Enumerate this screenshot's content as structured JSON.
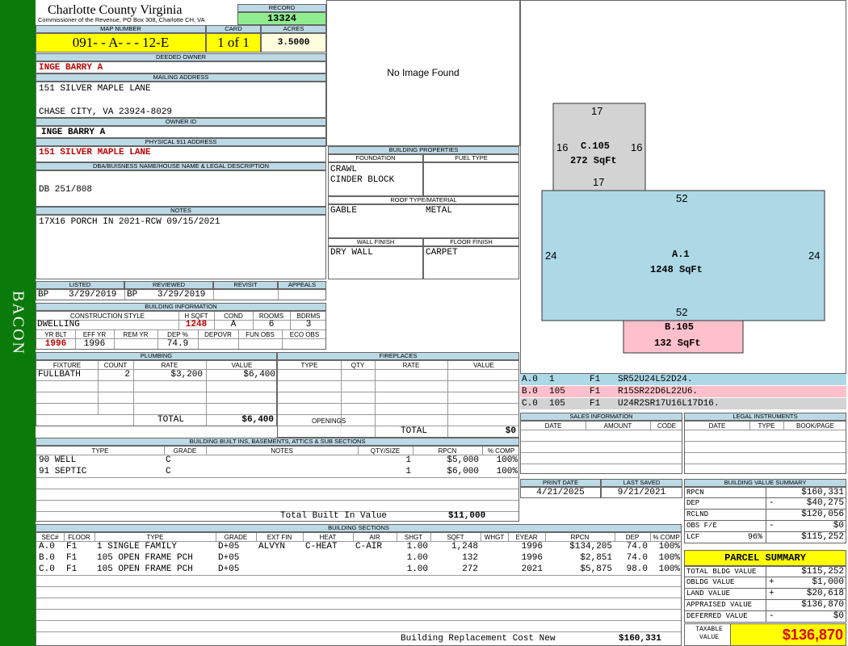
{
  "side_label": "BACON",
  "county": {
    "name": "Charlotte County Virginia",
    "sub": "Commissioner of the Revenue, PO Box 308, Charlotte CH, VA"
  },
  "record": {
    "label": "RECORD",
    "value": "13324"
  },
  "map": {
    "label": "MAP NUMBER",
    "value": "091- - A- - - 12-E"
  },
  "card": {
    "label": "CARD",
    "value": "1 of 1"
  },
  "acres": {
    "label": "ACRES",
    "value": "3.5000"
  },
  "deeded_owner": {
    "label": "DEEDED OWNER",
    "value": "INGE BARRY A"
  },
  "mailing": {
    "label": "MAILING ADDRESS",
    "line1": "151 SILVER MAPLE LANE",
    "line2": "CHASE CITY, VA 23924-8029"
  },
  "owner_id": {
    "label": "OWNER ID",
    "value": "INGE BARRY A"
  },
  "physical": {
    "label": "PHYSICAL 911 ADDRESS",
    "value": "151 SILVER MAPLE LANE"
  },
  "dba": {
    "label": "DBA/BUISNESS NAME/HOUSE NAME & LEGAL DESCRIPTION",
    "value": "DB 251/808"
  },
  "notes": {
    "label": "NOTES",
    "value": "17X16 PORCH IN 2021-RCW 09/15/2021"
  },
  "image_text": "No Image Found",
  "building_props": {
    "label": "BUILDING PROPERTIES",
    "foundation_label": "FOUNDATION",
    "fuel_label": "FUEL TYPE",
    "foundation1": "CRAWL",
    "foundation2": "CINDER BLOCK",
    "fuel": "",
    "roof_label": "ROOF TYPE/MATERIAL",
    "roof_type": "GABLE",
    "roof_material": "METAL",
    "wall_label": "WALL FINISH",
    "floor_label": "FLOOR FINISH",
    "wall": "DRY WALL",
    "floor": "CARPET"
  },
  "review": {
    "listed_label": "LISTED",
    "reviewed_label": "REVIEWED",
    "revisit_label": "REVISIT",
    "appeals_label": "APPEALS",
    "listed_by": "BP",
    "listed_date": "3/29/2019",
    "reviewed_by": "BP",
    "reviewed_date": "3/29/2019",
    "revisit": "",
    "appeals": ""
  },
  "building_info": {
    "label": "BUILDING INFORMATION",
    "construction_label": "CONSTRUCTION STYLE",
    "hsqft_label": "H SQFT",
    "cond_label": "COND",
    "rooms_label": "ROOMS",
    "bdrms_label": "BDRMS",
    "construction": "DWELLING",
    "hsqft": "1248",
    "cond": "A",
    "rooms": "6",
    "bdrms": "3",
    "yrblt_label": "YR BLT",
    "effyr_label": "EFF YR",
    "remyr_label": "REM YR",
    "dep_label": "DEP %",
    "depovr_label": "DEPOVR",
    "funobs_label": "FUN OBS",
    "ecoobs_label": "ECO OBS",
    "yrblt": "1996",
    "effyr": "1996",
    "remyr": "",
    "dep": "74.9",
    "depovr": "",
    "funobs": "",
    "ecoobs": ""
  },
  "plumbing": {
    "label": "PLUMBING",
    "fixture_label": "FIXTURE",
    "count_label": "COUNT",
    "rate_label": "RATE",
    "value_label": "VALUE",
    "rows": [
      {
        "fixture": "FULLBATH",
        "count": "2",
        "rate": "$3,200",
        "value": "$6,400"
      }
    ],
    "total_label": "TOTAL",
    "total": "$6,400"
  },
  "fireplaces": {
    "label": "FIREPLACES",
    "type_label": "TYPE",
    "qty_label": "QTY",
    "rate_label": "RATE",
    "value_label": "VALUE",
    "openings_label": "OPENINGS",
    "total_label": "TOTAL",
    "total": "$0"
  },
  "builtins": {
    "label": "BUILDING BUILT INS, BASEMENTS, ATTICS & SUB SECTIONS",
    "type_label": "TYPE",
    "grade_label": "GRADE",
    "notes_label": "NOTES",
    "qty_label": "QTY/SIZE",
    "rpcn_label": "RPCN",
    "comp_label": "% COMP",
    "rows": [
      {
        "type": "90 WELL",
        "grade": "C",
        "notes": "",
        "qty": "1",
        "rpcn": "$5,000",
        "comp": "100%"
      },
      {
        "type": "91 SEPTIC",
        "grade": "C",
        "notes": "",
        "qty": "1",
        "rpcn": "$6,000",
        "comp": "100%"
      }
    ],
    "total_label": "Total Built In Value",
    "total": "$11,000"
  },
  "sections": {
    "label": "BUILDING SECTIONS",
    "headers": [
      "SEC#",
      "FLOOR",
      "TYPE",
      "GRADE",
      "EXT FIN",
      "HEAT",
      "AIR",
      "SHGT",
      "SQFT",
      "WHGT",
      "EYEAR",
      "RPCN",
      "DEP",
      "% COMP"
    ],
    "rows": [
      {
        "sec": "A.0",
        "floor": "F1",
        "type": "1 SINGLE FAMILY",
        "grade": "D+05",
        "extfin": "ALVYN",
        "heat": "C-HEAT",
        "air": "C-AIR",
        "shgt": "1.00",
        "sqft": "1,248",
        "whgt": "",
        "eyear": "1996",
        "rpcn": "$134,205",
        "dep": "74.0",
        "comp": "100%"
      },
      {
        "sec": "B.0",
        "floor": "F1",
        "type": "105 OPEN FRAME PCH",
        "grade": "D+05",
        "extfin": "",
        "heat": "",
        "air": "",
        "shgt": "1.00",
        "sqft": "132",
        "whgt": "",
        "eyear": "1996",
        "rpcn": "$2,851",
        "dep": "74.0",
        "comp": "100%"
      },
      {
        "sec": "C.0",
        "floor": "F1",
        "type": "105 OPEN FRAME PCH",
        "grade": "D+05",
        "extfin": "",
        "heat": "",
        "air": "",
        "shgt": "1.00",
        "sqft": "272",
        "whgt": "",
        "eyear": "2021",
        "rpcn": "$5,875",
        "dep": "98.0",
        "comp": "100%"
      }
    ],
    "replacement_label": "Building Replacement Cost New",
    "replacement": "$160,331"
  },
  "sketch": {
    "c_top": "17",
    "c_left": "16",
    "c_right": "16",
    "c_bottom": "17",
    "c_name": "C.105",
    "c_area": "272 SqFt",
    "a_top": "52",
    "a_left": "24",
    "a_right": "24",
    "a_bottom": "52",
    "a_name": "A.1",
    "a_area": "1248 SqFt",
    "b_name": "B.105",
    "b_area": "132 SqFt",
    "colors": {
      "a": "#add8e6",
      "b": "#ffc0cb",
      "c": "#d3d3d3"
    }
  },
  "legend": [
    {
      "sec": "A.0",
      "code": "1",
      "floor": "F1",
      "path": "SR52U24L52D24."
    },
    {
      "sec": "B.0",
      "code": "105",
      "floor": "F1",
      "path": "R15SR22D6L22U6."
    },
    {
      "sec": "C.0",
      "code": "105",
      "floor": "F1",
      "path": "U24R2SR17U16L17D16."
    }
  ],
  "sales": {
    "label": "SALES INFORMATION",
    "date_label": "DATE",
    "amount_label": "AMOUNT",
    "code_label": "CODE"
  },
  "legal": {
    "label": "LEGAL INSTRUMENTS",
    "date_label": "DATE",
    "type_label": "TYPE",
    "book_label": "BOOK/PAGE"
  },
  "print": {
    "print_label": "PRINT DATE",
    "saved_label": "LAST SAVED",
    "print_date": "4/21/2025",
    "saved_date": "9/21/2021"
  },
  "value_summary": {
    "label": "BUILDING VALUE SUMMARY",
    "rows": [
      {
        "label": "RPCN",
        "sign": "",
        "value": "$160,331"
      },
      {
        "label": "DEP",
        "sign": "-",
        "value": "$40,275"
      },
      {
        "label": "RCLND",
        "sign": "",
        "value": "$120,056"
      },
      {
        "label": "OBS F/E",
        "sign": "-",
        "value": "$0"
      },
      {
        "label": "LCF",
        "pct": "96%",
        "sign": "",
        "value": "$115,252"
      }
    ]
  },
  "parcel": {
    "title": "PARCEL SUMMARY",
    "rows": [
      {
        "label": "TOTAL BLDG VALUE",
        "sign": "",
        "value": "$115,252"
      },
      {
        "label": "OBLDG VALUE",
        "sign": "+",
        "value": "$1,000"
      },
      {
        "label": "LAND VALUE",
        "sign": "+",
        "value": "$20,618"
      },
      {
        "label": "APPRAISED VALUE",
        "sign": "",
        "value": "$136,870"
      },
      {
        "label": "DEFERRED VALUE",
        "sign": "-",
        "value": "$0"
      }
    ],
    "taxable_label": "TAXABLE VALUE",
    "taxable": "$136,870"
  }
}
